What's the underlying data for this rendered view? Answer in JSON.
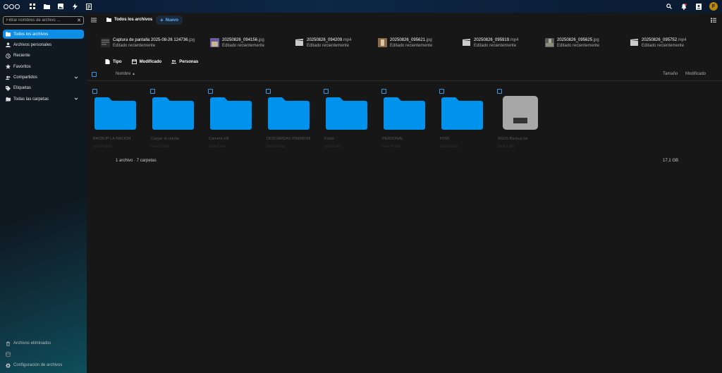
{
  "topbar": {
    "logo": "nextcloud-logo",
    "apps": [
      "dashboard-icon",
      "files-icon",
      "photos-icon",
      "activity-icon",
      "notes-icon"
    ],
    "right_icons": [
      "search-icon",
      "notifications-icon",
      "contacts-icon"
    ],
    "avatar_initial": "F",
    "avatar_color": "#b8860b"
  },
  "sidebar": {
    "filter_placeholder": "Filtrar nombres de archivo ...",
    "items": [
      {
        "label": "Todos los archivos",
        "icon": "folder-icon",
        "active": true
      },
      {
        "label": "Archivos personales",
        "icon": "user-icon"
      },
      {
        "label": "Reciente",
        "icon": "clock-icon"
      },
      {
        "label": "Favoritos",
        "icon": "star-icon"
      },
      {
        "label": "Compartidos",
        "icon": "share-icon",
        "chevron": true
      },
      {
        "label": "Etiquetas",
        "icon": "tag-icon"
      },
      {
        "label": "Todas las carpetas",
        "icon": "folder-multiple-icon",
        "chevron": true
      }
    ],
    "bottom": [
      {
        "label": "Archivos eliminados",
        "icon": "trash-icon"
      },
      {
        "label": "",
        "icon": "storage-icon"
      },
      {
        "label": "Configuración de archivos",
        "icon": "gear-icon"
      }
    ]
  },
  "toolbar": {
    "breadcrumb": "Todos los archivos",
    "new_label": "Nuevo"
  },
  "recent": [
    {
      "name": "Captura de pantalla 2025-08-26 124736",
      "ext": ".jpg",
      "status": "Editado recientemente",
      "thumb": "screenshot"
    },
    {
      "name": "20250826_094156",
      "ext": ".jpg",
      "status": "Editado recientemente",
      "thumb": "photo-purple"
    },
    {
      "name": "20250826_094209",
      "ext": ".mp4",
      "status": "Editado recientemente",
      "thumb": "video"
    },
    {
      "name": "20250826_095621",
      "ext": ".jpg",
      "status": "Editado recientemente",
      "thumb": "photo-brown"
    },
    {
      "name": "20250826_095919",
      "ext": ".mp4",
      "status": "Editado recientemente",
      "thumb": "video"
    },
    {
      "name": "20250826_095625",
      "ext": ".jpg",
      "status": "Editado recientemente",
      "thumb": "photo-street"
    },
    {
      "name": "20250826_095752",
      "ext": ".mp4",
      "status": "Editado recientemente",
      "thumb": "video"
    }
  ],
  "filters": [
    {
      "label": "Tipo",
      "icon": "file-icon"
    },
    {
      "label": "Modificado",
      "icon": "calendar-icon"
    },
    {
      "label": "Personas",
      "icon": "people-icon"
    }
  ],
  "columns": {
    "name": "Nombre",
    "size": "Tamaño",
    "modified": "Modificado"
  },
  "tiles": [
    {
      "name": "BACKUP LA NACION",
      "sub": "hace 4 días",
      "type": "folder"
    },
    {
      "name": "Cargar al celular",
      "sub": "hace 2 días",
      "type": "folder"
    },
    {
      "name": "Camera roll",
      "sub": "hace 1 día",
      "type": "folder"
    },
    {
      "name": "DESCARGAS PREMIUM",
      "sub": "hace 3 días",
      "type": "folder"
    },
    {
      "name": "Fotos",
      "sub": "hace 1 día",
      "type": "folder"
    },
    {
      "name": "PERSONAL",
      "sub": "hace 4 días",
      "type": "folder"
    },
    {
      "name": "POW",
      "sub": "hace 3 días",
      "type": "folder"
    },
    {
      "name": "ASUS Backup.tar",
      "sub": "hace 1 día",
      "type": "archive"
    }
  ],
  "summary": {
    "count": "1 archivo · 7 carpetas",
    "size": "17,1 GB"
  },
  "colors": {
    "accent": "#0c8de6",
    "folder": "#0093ee",
    "background": "#171717"
  }
}
